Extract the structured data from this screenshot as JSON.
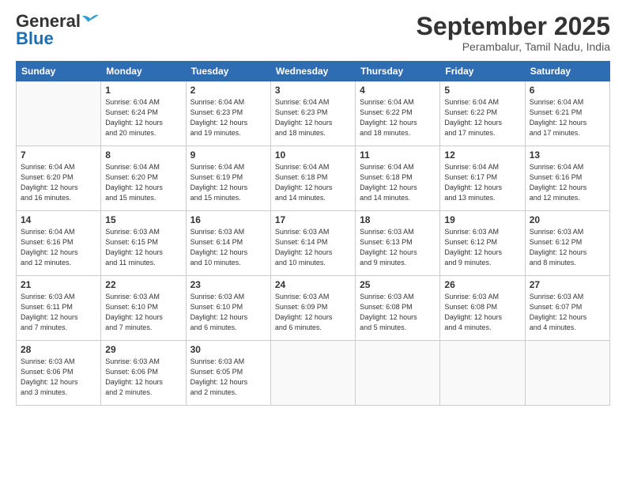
{
  "header": {
    "logo_general": "General",
    "logo_blue": "Blue",
    "month_title": "September 2025",
    "subtitle": "Perambalur, Tamil Nadu, India"
  },
  "weekdays": [
    "Sunday",
    "Monday",
    "Tuesday",
    "Wednesday",
    "Thursday",
    "Friday",
    "Saturday"
  ],
  "weeks": [
    [
      {
        "num": "",
        "empty": true
      },
      {
        "num": "1",
        "sunrise": "6:04 AM",
        "sunset": "6:24 PM",
        "daylight": "12 hours and 20 minutes."
      },
      {
        "num": "2",
        "sunrise": "6:04 AM",
        "sunset": "6:23 PM",
        "daylight": "12 hours and 19 minutes."
      },
      {
        "num": "3",
        "sunrise": "6:04 AM",
        "sunset": "6:23 PM",
        "daylight": "12 hours and 18 minutes."
      },
      {
        "num": "4",
        "sunrise": "6:04 AM",
        "sunset": "6:22 PM",
        "daylight": "12 hours and 18 minutes."
      },
      {
        "num": "5",
        "sunrise": "6:04 AM",
        "sunset": "6:22 PM",
        "daylight": "12 hours and 17 minutes."
      },
      {
        "num": "6",
        "sunrise": "6:04 AM",
        "sunset": "6:21 PM",
        "daylight": "12 hours and 17 minutes."
      }
    ],
    [
      {
        "num": "7",
        "sunrise": "6:04 AM",
        "sunset": "6:20 PM",
        "daylight": "12 hours and 16 minutes."
      },
      {
        "num": "8",
        "sunrise": "6:04 AM",
        "sunset": "6:20 PM",
        "daylight": "12 hours and 15 minutes."
      },
      {
        "num": "9",
        "sunrise": "6:04 AM",
        "sunset": "6:19 PM",
        "daylight": "12 hours and 15 minutes."
      },
      {
        "num": "10",
        "sunrise": "6:04 AM",
        "sunset": "6:18 PM",
        "daylight": "12 hours and 14 minutes."
      },
      {
        "num": "11",
        "sunrise": "6:04 AM",
        "sunset": "6:18 PM",
        "daylight": "12 hours and 14 minutes."
      },
      {
        "num": "12",
        "sunrise": "6:04 AM",
        "sunset": "6:17 PM",
        "daylight": "12 hours and 13 minutes."
      },
      {
        "num": "13",
        "sunrise": "6:04 AM",
        "sunset": "6:16 PM",
        "daylight": "12 hours and 12 minutes."
      }
    ],
    [
      {
        "num": "14",
        "sunrise": "6:04 AM",
        "sunset": "6:16 PM",
        "daylight": "12 hours and 12 minutes."
      },
      {
        "num": "15",
        "sunrise": "6:03 AM",
        "sunset": "6:15 PM",
        "daylight": "12 hours and 11 minutes."
      },
      {
        "num": "16",
        "sunrise": "6:03 AM",
        "sunset": "6:14 PM",
        "daylight": "12 hours and 10 minutes."
      },
      {
        "num": "17",
        "sunrise": "6:03 AM",
        "sunset": "6:14 PM",
        "daylight": "12 hours and 10 minutes."
      },
      {
        "num": "18",
        "sunrise": "6:03 AM",
        "sunset": "6:13 PM",
        "daylight": "12 hours and 9 minutes."
      },
      {
        "num": "19",
        "sunrise": "6:03 AM",
        "sunset": "6:12 PM",
        "daylight": "12 hours and 9 minutes."
      },
      {
        "num": "20",
        "sunrise": "6:03 AM",
        "sunset": "6:12 PM",
        "daylight": "12 hours and 8 minutes."
      }
    ],
    [
      {
        "num": "21",
        "sunrise": "6:03 AM",
        "sunset": "6:11 PM",
        "daylight": "12 hours and 7 minutes."
      },
      {
        "num": "22",
        "sunrise": "6:03 AM",
        "sunset": "6:10 PM",
        "daylight": "12 hours and 7 minutes."
      },
      {
        "num": "23",
        "sunrise": "6:03 AM",
        "sunset": "6:10 PM",
        "daylight": "12 hours and 6 minutes."
      },
      {
        "num": "24",
        "sunrise": "6:03 AM",
        "sunset": "6:09 PM",
        "daylight": "12 hours and 6 minutes."
      },
      {
        "num": "25",
        "sunrise": "6:03 AM",
        "sunset": "6:08 PM",
        "daylight": "12 hours and 5 minutes."
      },
      {
        "num": "26",
        "sunrise": "6:03 AM",
        "sunset": "6:08 PM",
        "daylight": "12 hours and 4 minutes."
      },
      {
        "num": "27",
        "sunrise": "6:03 AM",
        "sunset": "6:07 PM",
        "daylight": "12 hours and 4 minutes."
      }
    ],
    [
      {
        "num": "28",
        "sunrise": "6:03 AM",
        "sunset": "6:06 PM",
        "daylight": "12 hours and 3 minutes."
      },
      {
        "num": "29",
        "sunrise": "6:03 AM",
        "sunset": "6:06 PM",
        "daylight": "12 hours and 2 minutes."
      },
      {
        "num": "30",
        "sunrise": "6:03 AM",
        "sunset": "6:05 PM",
        "daylight": "12 hours and 2 minutes."
      },
      {
        "num": "",
        "empty": true
      },
      {
        "num": "",
        "empty": true
      },
      {
        "num": "",
        "empty": true
      },
      {
        "num": "",
        "empty": true
      }
    ]
  ]
}
